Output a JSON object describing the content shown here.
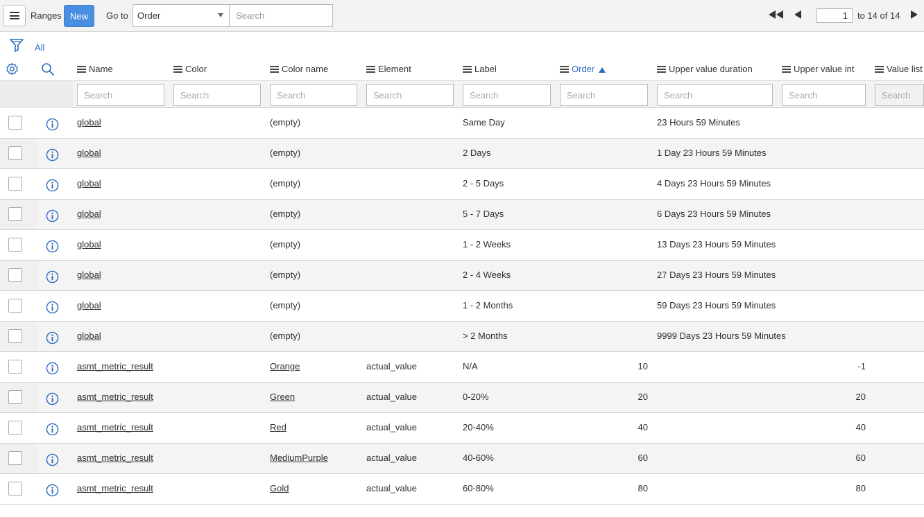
{
  "header": {
    "ranges_label": "Ranges",
    "new_label": "New",
    "goto_label": "Go to",
    "goto_field": "Order",
    "search_placeholder": "Search",
    "page_value": "1",
    "page_of": "to 14 of 14"
  },
  "filter": {
    "all_label": "All"
  },
  "columns": {
    "name": "Name",
    "color": "Color",
    "color_name": "Color name",
    "element": "Element",
    "label": "Label",
    "order": "Order",
    "upper_value_duration": "Upper value duration",
    "upper_value_int": "Upper value int",
    "value_list": "Value list"
  },
  "column_search_placeholder": "Search",
  "rows": [
    {
      "name": "global",
      "color_name": "(empty)",
      "element": "",
      "label": "Same Day",
      "order": "",
      "upper_value_duration": "23 Hours 59 Minutes",
      "upper_value_int": ""
    },
    {
      "name": "global",
      "color_name": "(empty)",
      "element": "",
      "label": "2 Days",
      "order": "",
      "upper_value_duration": "1 Day 23 Hours 59 Minutes",
      "upper_value_int": ""
    },
    {
      "name": "global",
      "color_name": "(empty)",
      "element": "",
      "label": "2 - 5 Days",
      "order": "",
      "upper_value_duration": "4 Days 23 Hours 59 Minutes",
      "upper_value_int": ""
    },
    {
      "name": "global",
      "color_name": "(empty)",
      "element": "",
      "label": "5 - 7 Days",
      "order": "",
      "upper_value_duration": "6 Days 23 Hours 59 Minutes",
      "upper_value_int": ""
    },
    {
      "name": "global",
      "color_name": "(empty)",
      "element": "",
      "label": "1 - 2 Weeks",
      "order": "",
      "upper_value_duration": "13 Days 23 Hours 59 Minutes",
      "upper_value_int": ""
    },
    {
      "name": "global",
      "color_name": "(empty)",
      "element": "",
      "label": "2 - 4 Weeks",
      "order": "",
      "upper_value_duration": "27 Days 23 Hours 59 Minutes",
      "upper_value_int": ""
    },
    {
      "name": "global",
      "color_name": "(empty)",
      "element": "",
      "label": "1 - 2 Months",
      "order": "",
      "upper_value_duration": "59 Days 23 Hours 59 Minutes",
      "upper_value_int": ""
    },
    {
      "name": "global",
      "color_name": "(empty)",
      "element": "",
      "label": "> 2 Months",
      "order": "",
      "upper_value_duration": "9999 Days 23 Hours 59 Minutes",
      "upper_value_int": ""
    },
    {
      "name": "asmt_metric_result",
      "color_name": "Orange",
      "element": "actual_value",
      "label": "N/A",
      "order": "10",
      "upper_value_duration": "",
      "upper_value_int": "-1"
    },
    {
      "name": "asmt_metric_result",
      "color_name": "Green",
      "element": "actual_value",
      "label": "0-20%",
      "order": "20",
      "upper_value_duration": "",
      "upper_value_int": "20"
    },
    {
      "name": "asmt_metric_result",
      "color_name": "Red",
      "element": "actual_value",
      "label": "20-40%",
      "order": "40",
      "upper_value_duration": "",
      "upper_value_int": "40"
    },
    {
      "name": "asmt_metric_result",
      "color_name": "MediumPurple",
      "element": "actual_value",
      "label": "40-60%",
      "order": "60",
      "upper_value_duration": "",
      "upper_value_int": "60"
    },
    {
      "name": "asmt_metric_result",
      "color_name": "Gold",
      "element": "actual_value",
      "label": "60-80%",
      "order": "80",
      "upper_value_duration": "",
      "upper_value_int": "80"
    }
  ],
  "colors": {
    "accent": "#4a8ee0",
    "link": "#2d6bbf",
    "icon_blue": "#2d6bbf"
  },
  "icons": [
    "menu-icon",
    "filter-icon",
    "gear-icon",
    "search-icon",
    "info-icon",
    "first-page-icon",
    "prev-page-icon",
    "next-page-icon",
    "sort-asc-icon"
  ]
}
